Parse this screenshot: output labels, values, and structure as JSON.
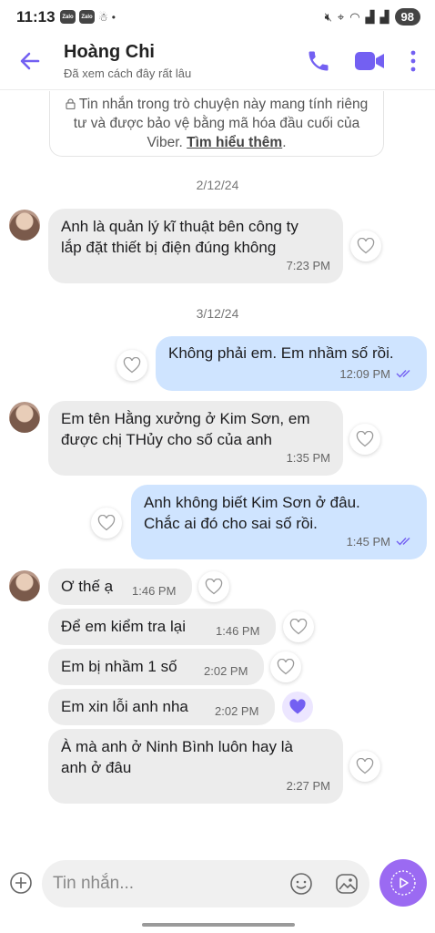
{
  "status_bar": {
    "time": "11:13",
    "zalo1": "Zalo",
    "zalo2": "Zalo",
    "battery": "98"
  },
  "header": {
    "name": "Hoàng Chi",
    "subtitle": "Đã xem cách đây rất lâu"
  },
  "notice": {
    "text": "Tin nhắn trong trò chuyện này mang tính riêng tư và được bảo vệ bằng mã hóa đầu cuối của Viber.",
    "link": "Tìm hiểu thêm",
    "suffix": "."
  },
  "dates": [
    "2/12/24",
    "3/12/24"
  ],
  "messages": [
    {
      "dir": "in",
      "lines": [
        "Anh là quản lý kĩ thuật bên công ty",
        "lắp đặt thiết bị điện đúng không"
      ],
      "time": "7:23 PM",
      "liked": false
    },
    {
      "dir": "out",
      "lines": [
        "Không phải em. Em nhầm số rồi."
      ],
      "time": "12:09 PM",
      "liked": false
    },
    {
      "dir": "in",
      "lines": [
        "Em tên Hằng xưởng ở Kim Sơn, em",
        "được chị THủy cho số của anh"
      ],
      "time": "1:35 PM",
      "liked": false
    },
    {
      "dir": "out",
      "lines": [
        "Anh không biết Kim Sơn ở đâu.",
        "Chắc ai đó cho sai số rồi."
      ],
      "time": "1:45 PM",
      "liked": false
    },
    {
      "dir": "in",
      "lines": [
        "Ơ thế ạ"
      ],
      "time": "1:46 PM",
      "liked": false
    },
    {
      "dir": "in",
      "lines": [
        "Để em kiểm tra lại"
      ],
      "time": "1:46 PM",
      "liked": false
    },
    {
      "dir": "in",
      "lines": [
        "Em bị nhầm 1 số"
      ],
      "time": "2:02 PM",
      "liked": false
    },
    {
      "dir": "in",
      "lines": [
        "Em xin lỗi anh nha"
      ],
      "time": "2:02 PM",
      "liked": true
    },
    {
      "dir": "in",
      "lines": [
        "À mà anh ở Ninh Bình luôn hay là",
        "anh ở đâu"
      ],
      "time": "2:27 PM",
      "liked": false
    }
  ],
  "composer": {
    "placeholder": "Tin nhắn..."
  },
  "colors": {
    "accent": "#7360f2",
    "incoming_bubble": "#ececec",
    "outgoing_bubble": "#cfe4ff",
    "send_button": "#9b6af2"
  }
}
